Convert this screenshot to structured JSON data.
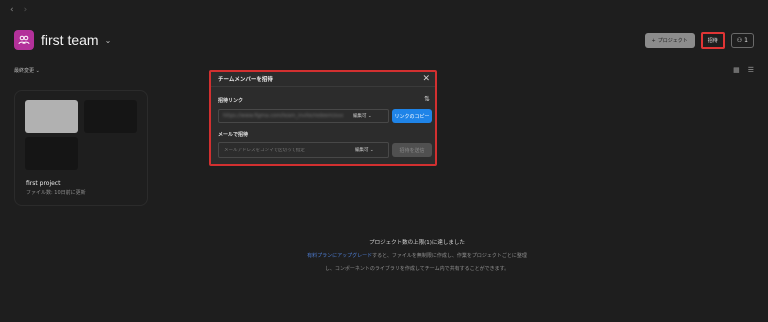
{
  "nav": {
    "back_icon": "‹",
    "forward_icon": "›"
  },
  "team": {
    "name": "first team",
    "chevron": "⌄",
    "avatar_color": "#b3319a"
  },
  "header": {
    "project_button": {
      "icon": "+",
      "label": "プロジェクト"
    },
    "invite_button": "招待",
    "members_button": {
      "icon": "⚇",
      "count": "1"
    }
  },
  "sort": {
    "label": "最終変更 ⌄"
  },
  "view": {
    "grid_icon": "▦",
    "list_icon": "☰"
  },
  "project": {
    "name": "first project",
    "meta": "ファイル数: 10日前に更新"
  },
  "limit": {
    "title": "プロジェクト数の上限(1)に達しました",
    "link": "有料プランにアップグレード",
    "line1_rest": "すると、ファイルを無制限に作成し、作業をプロジェクトごとに整理",
    "line2": "し、コンポーネントのライブラリを作成してチーム内で共有することができます。"
  },
  "modal": {
    "title": "チームメンバーを招待",
    "close_icon": "✕",
    "link_label": "招待リンク",
    "settings_icon": "⇅",
    "link_url": "https://www.figma.com/team_invite/redeem/xxxxxxxxxxxx",
    "link_permission": "編集可 ⌄",
    "copy_button": "リンクのコピー",
    "email_label": "メールで招待",
    "email_placeholder": "メールアドレスをコンマで区切って指定",
    "email_permission": "編集可 ⌄",
    "send_button": "招待を送信"
  },
  "colors": {
    "accent": "#1f84e8",
    "highlight": "#e03535",
    "background": "#1e1e1e"
  }
}
